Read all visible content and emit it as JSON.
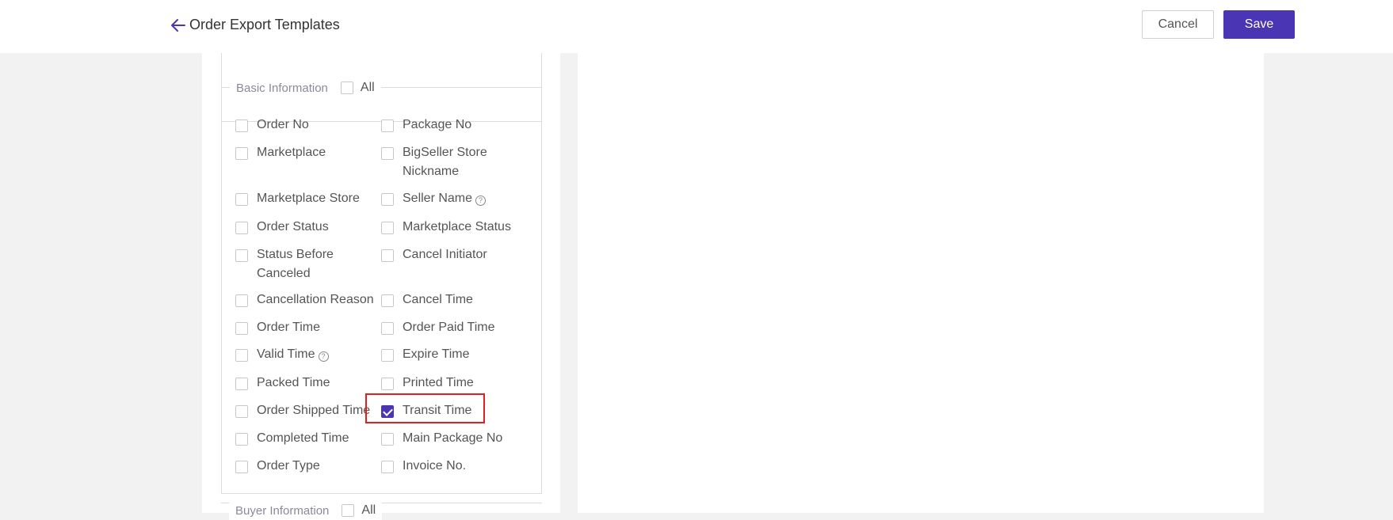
{
  "header": {
    "title": "Order Export Templates",
    "cancel_label": "Cancel",
    "save_label": "Save"
  },
  "accent_color": "#4a35b5",
  "basic_information": {
    "legend": "Basic Information",
    "all_label": "All",
    "left_column": [
      {
        "label": "Order No",
        "checked": false
      },
      {
        "label": "Marketplace",
        "checked": false
      },
      {
        "label": "Marketplace Store",
        "checked": false
      },
      {
        "label": "Order Status",
        "checked": false
      },
      {
        "label": "Status Before Canceled",
        "checked": false
      },
      {
        "label": "Cancellation Reason",
        "checked": false
      },
      {
        "label": "Order Time",
        "checked": false
      },
      {
        "label": "Valid Time",
        "checked": false,
        "help": true
      },
      {
        "label": "Packed Time",
        "checked": false
      },
      {
        "label": "Order Shipped Time",
        "checked": false
      },
      {
        "label": "Completed Time",
        "checked": false
      },
      {
        "label": "Order Type",
        "checked": false
      }
    ],
    "right_column": [
      {
        "label": "Package No",
        "checked": false
      },
      {
        "label": "BigSeller Store Nickname",
        "checked": false
      },
      {
        "label": "Seller Name",
        "checked": false,
        "help": true
      },
      {
        "label": "Marketplace Status",
        "checked": false
      },
      {
        "label": "Cancel Initiator",
        "checked": false
      },
      {
        "label": "Cancel Time",
        "checked": false
      },
      {
        "label": "Order Paid Time",
        "checked": false
      },
      {
        "label": "Expire Time",
        "checked": false
      },
      {
        "label": "Printed Time",
        "checked": false
      },
      {
        "label": "Transit Time",
        "checked": true,
        "highlighted": true
      },
      {
        "label": "Main Package No",
        "checked": false
      },
      {
        "label": "Invoice No.",
        "checked": false
      }
    ]
  },
  "buyer_information": {
    "legend": "Buyer Information",
    "all_label": "All"
  }
}
